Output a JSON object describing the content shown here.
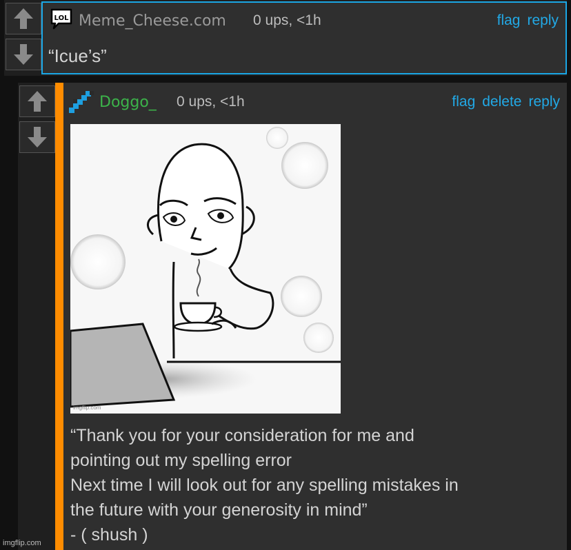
{
  "comments": [
    {
      "username": "Meme_Cheese.com",
      "username_color": "#9a9a9a",
      "avatar_icon": "lol-speech-bubble-icon",
      "ups": "0 ups, <1h",
      "actions": [
        "flag",
        "reply"
      ],
      "text": "“Icue’s”"
    },
    {
      "username": "Doggo_",
      "username_color": "#3cb34a",
      "avatar_icon": "pixel-diagonal-icon",
      "ups": "0 ups, <1h",
      "actions": [
        "flag",
        "delete",
        "reply"
      ],
      "image_watermark": "imgflip.com",
      "text": "“Thank you for your consideration for me and\npointing out my spelling error\nNext time I will look out for any spelling mistakes in\nthe future with your generosity in mind”\n- ( shush )"
    }
  ],
  "colors": {
    "accent_blue": "#22a9e6",
    "highlight_border": "#1aa7e6",
    "reply_bar": "#ff8c00",
    "background": "#111111",
    "panel": "#2f2f2f"
  },
  "site_watermark": "imgflip.com"
}
